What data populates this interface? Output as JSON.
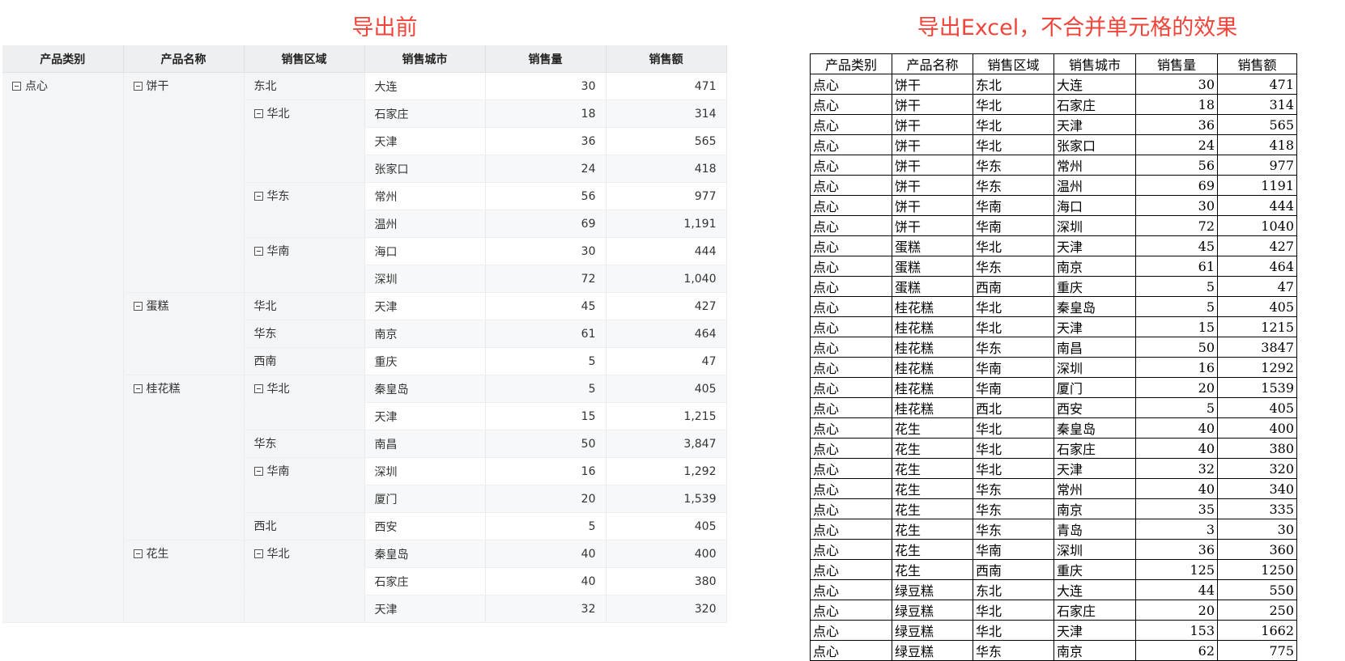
{
  "captions": {
    "before": "导出前",
    "after": "导出Excel，不合并单元格的效果"
  },
  "colors": {
    "caption": "#f0453b",
    "header_bg": "#edeff1",
    "tree_bg": "#f4f5f7"
  },
  "icons": {
    "collapse": "collapse-icon"
  },
  "headers": [
    "产品类别",
    "产品名称",
    "销售区域",
    "销售城市",
    "销售量",
    "销售额"
  ],
  "tree": {
    "rows": [
      {
        "cat": "点心",
        "prod": "饼干",
        "region": "东北",
        "region_toggle": false,
        "city": "大连",
        "qty": "30",
        "amt": "471"
      },
      {
        "cat": "",
        "prod": "",
        "region": "华北",
        "region_toggle": true,
        "city": "石家庄",
        "qty": "18",
        "amt": "314"
      },
      {
        "cat": "",
        "prod": "",
        "region": "",
        "region_toggle": false,
        "city": "天津",
        "qty": "36",
        "amt": "565"
      },
      {
        "cat": "",
        "prod": "",
        "region": "",
        "region_toggle": false,
        "city": "张家口",
        "qty": "24",
        "amt": "418"
      },
      {
        "cat": "",
        "prod": "",
        "region": "华东",
        "region_toggle": true,
        "city": "常州",
        "qty": "56",
        "amt": "977"
      },
      {
        "cat": "",
        "prod": "",
        "region": "",
        "region_toggle": false,
        "city": "温州",
        "qty": "69",
        "amt": "1,191"
      },
      {
        "cat": "",
        "prod": "",
        "region": "华南",
        "region_toggle": true,
        "city": "海口",
        "qty": "30",
        "amt": "444"
      },
      {
        "cat": "",
        "prod": "",
        "region": "",
        "region_toggle": false,
        "city": "深圳",
        "qty": "72",
        "amt": "1,040"
      },
      {
        "cat": "",
        "prod": "蛋糕",
        "region": "华北",
        "region_toggle": false,
        "city": "天津",
        "qty": "45",
        "amt": "427"
      },
      {
        "cat": "",
        "prod": "",
        "region": "华东",
        "region_toggle": false,
        "city": "南京",
        "qty": "61",
        "amt": "464"
      },
      {
        "cat": "",
        "prod": "",
        "region": "西南",
        "region_toggle": false,
        "city": "重庆",
        "qty": "5",
        "amt": "47"
      },
      {
        "cat": "",
        "prod": "桂花糕",
        "region": "华北",
        "region_toggle": true,
        "city": "秦皇岛",
        "qty": "5",
        "amt": "405"
      },
      {
        "cat": "",
        "prod": "",
        "region": "",
        "region_toggle": false,
        "city": "天津",
        "qty": "15",
        "amt": "1,215"
      },
      {
        "cat": "",
        "prod": "",
        "region": "华东",
        "region_toggle": false,
        "city": "南昌",
        "qty": "50",
        "amt": "3,847"
      },
      {
        "cat": "",
        "prod": "",
        "region": "华南",
        "region_toggle": true,
        "city": "深圳",
        "qty": "16",
        "amt": "1,292"
      },
      {
        "cat": "",
        "prod": "",
        "region": "",
        "region_toggle": false,
        "city": "厦门",
        "qty": "20",
        "amt": "1,539"
      },
      {
        "cat": "",
        "prod": "",
        "region": "西北",
        "region_toggle": false,
        "city": "西安",
        "qty": "5",
        "amt": "405"
      },
      {
        "cat": "",
        "prod": "花生",
        "region": "华北",
        "region_toggle": true,
        "city": "秦皇岛",
        "qty": "40",
        "amt": "400"
      },
      {
        "cat": "",
        "prod": "",
        "region": "",
        "region_toggle": false,
        "city": "石家庄",
        "qty": "40",
        "amt": "380"
      },
      {
        "cat": "",
        "prod": "",
        "region": "",
        "region_toggle": false,
        "city": "天津",
        "qty": "32",
        "amt": "320"
      }
    ]
  },
  "excel": {
    "rows": [
      [
        "点心",
        "饼干",
        "东北",
        "大连",
        "30",
        "471"
      ],
      [
        "点心",
        "饼干",
        "华北",
        "石家庄",
        "18",
        "314"
      ],
      [
        "点心",
        "饼干",
        "华北",
        "天津",
        "36",
        "565"
      ],
      [
        "点心",
        "饼干",
        "华北",
        "张家口",
        "24",
        "418"
      ],
      [
        "点心",
        "饼干",
        "华东",
        "常州",
        "56",
        "977"
      ],
      [
        "点心",
        "饼干",
        "华东",
        "温州",
        "69",
        "1191"
      ],
      [
        "点心",
        "饼干",
        "华南",
        "海口",
        "30",
        "444"
      ],
      [
        "点心",
        "饼干",
        "华南",
        "深圳",
        "72",
        "1040"
      ],
      [
        "点心",
        "蛋糕",
        "华北",
        "天津",
        "45",
        "427"
      ],
      [
        "点心",
        "蛋糕",
        "华东",
        "南京",
        "61",
        "464"
      ],
      [
        "点心",
        "蛋糕",
        "西南",
        "重庆",
        "5",
        "47"
      ],
      [
        "点心",
        "桂花糕",
        "华北",
        "秦皇岛",
        "5",
        "405"
      ],
      [
        "点心",
        "桂花糕",
        "华北",
        "天津",
        "15",
        "1215"
      ],
      [
        "点心",
        "桂花糕",
        "华东",
        "南昌",
        "50",
        "3847"
      ],
      [
        "点心",
        "桂花糕",
        "华南",
        "深圳",
        "16",
        "1292"
      ],
      [
        "点心",
        "桂花糕",
        "华南",
        "厦门",
        "20",
        "1539"
      ],
      [
        "点心",
        "桂花糕",
        "西北",
        "西安",
        "5",
        "405"
      ],
      [
        "点心",
        "花生",
        "华北",
        "秦皇岛",
        "40",
        "400"
      ],
      [
        "点心",
        "花生",
        "华北",
        "石家庄",
        "40",
        "380"
      ],
      [
        "点心",
        "花生",
        "华北",
        "天津",
        "32",
        "320"
      ],
      [
        "点心",
        "花生",
        "华东",
        "常州",
        "40",
        "340"
      ],
      [
        "点心",
        "花生",
        "华东",
        "南京",
        "35",
        "335"
      ],
      [
        "点心",
        "花生",
        "华东",
        "青岛",
        "3",
        "30"
      ],
      [
        "点心",
        "花生",
        "华南",
        "深圳",
        "36",
        "360"
      ],
      [
        "点心",
        "花生",
        "西南",
        "重庆",
        "125",
        "1250"
      ],
      [
        "点心",
        "绿豆糕",
        "东北",
        "大连",
        "44",
        "550"
      ],
      [
        "点心",
        "绿豆糕",
        "华北",
        "石家庄",
        "20",
        "250"
      ],
      [
        "点心",
        "绿豆糕",
        "华北",
        "天津",
        "153",
        "1662"
      ],
      [
        "点心",
        "绿豆糕",
        "华东",
        "南京",
        "62",
        "775"
      ]
    ]
  }
}
